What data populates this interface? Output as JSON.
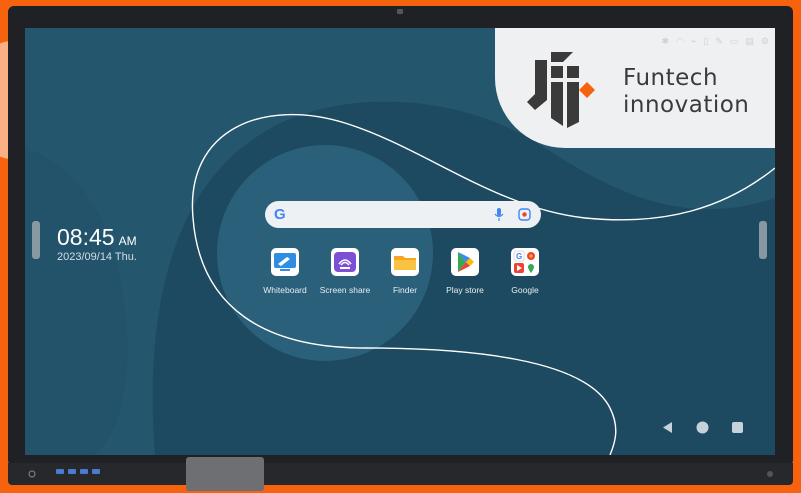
{
  "brand": {
    "name_line1": "Funtech",
    "name_line2": "innovation",
    "accent_color": "#f7620f"
  },
  "clock": {
    "time": "08:45",
    "ampm": "AM",
    "date": "2023/09/14 Thu."
  },
  "search": {
    "logo_letter": "G"
  },
  "apps": [
    {
      "label": "Whiteboard",
      "icon": "whiteboard-icon"
    },
    {
      "label": "Screen share",
      "icon": "screen-share-icon"
    },
    {
      "label": "Finder",
      "icon": "folder-icon"
    },
    {
      "label": "Play store",
      "icon": "play-store-icon"
    },
    {
      "label": "Google",
      "icon": "google-apps-icon"
    }
  ],
  "navigation": {
    "back": "back-icon",
    "home": "home-icon",
    "recents": "recents-icon"
  },
  "side_handles": {
    "left": "‹",
    "right": "‹"
  }
}
